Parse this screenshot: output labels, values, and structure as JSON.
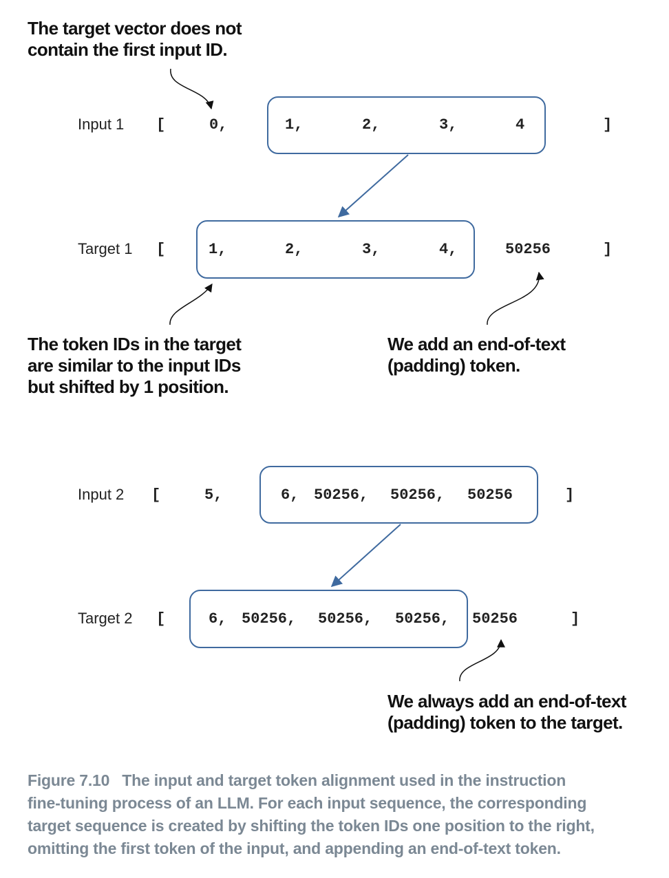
{
  "notes": {
    "target_excludes_first": [
      "The target vector does not",
      "contain the first input ID."
    ],
    "shifted": [
      "The token IDs in the target",
      "are similar to the input IDs",
      "but shifted by 1 position."
    ],
    "padding_added": [
      "We add an end-of-text",
      "(padding) token."
    ],
    "padding_always": [
      "We always add an end-of-text",
      "(padding) token to the target."
    ]
  },
  "example1": {
    "input": {
      "label": "Input 1",
      "open": "[",
      "tokens": [
        "0,",
        "1,",
        "2,",
        "3,",
        "4"
      ],
      "close": "]"
    },
    "target": {
      "label": "Target 1",
      "open": "[",
      "tokens": [
        "1,",
        "2,",
        "3,",
        "4,",
        "50256"
      ],
      "close": "]"
    }
  },
  "example2": {
    "input": {
      "label": "Input 2",
      "open": "[",
      "tokens": [
        "5,",
        "6,",
        "50256,",
        "50256,",
        "50256"
      ],
      "close": "]"
    },
    "target": {
      "label": "Target 2",
      "open": "[",
      "tokens": [
        "6,",
        "50256,",
        "50256,",
        "50256,",
        "50256"
      ],
      "close": "]"
    }
  },
  "colors": {
    "box_border": "#3f6a9f",
    "arrow": "#3f6a9f",
    "caption_text": "#7b8894"
  },
  "caption": {
    "figure_label": "Figure 7.10",
    "lines": [
      "The input and target token alignment used in the instruction",
      "fine-tuning process of an LLM. For each input sequence, the corresponding",
      "target sequence is created by shifting the token IDs one position to the right,",
      "omitting the first token of the input, and appending an end-of-text token."
    ]
  }
}
